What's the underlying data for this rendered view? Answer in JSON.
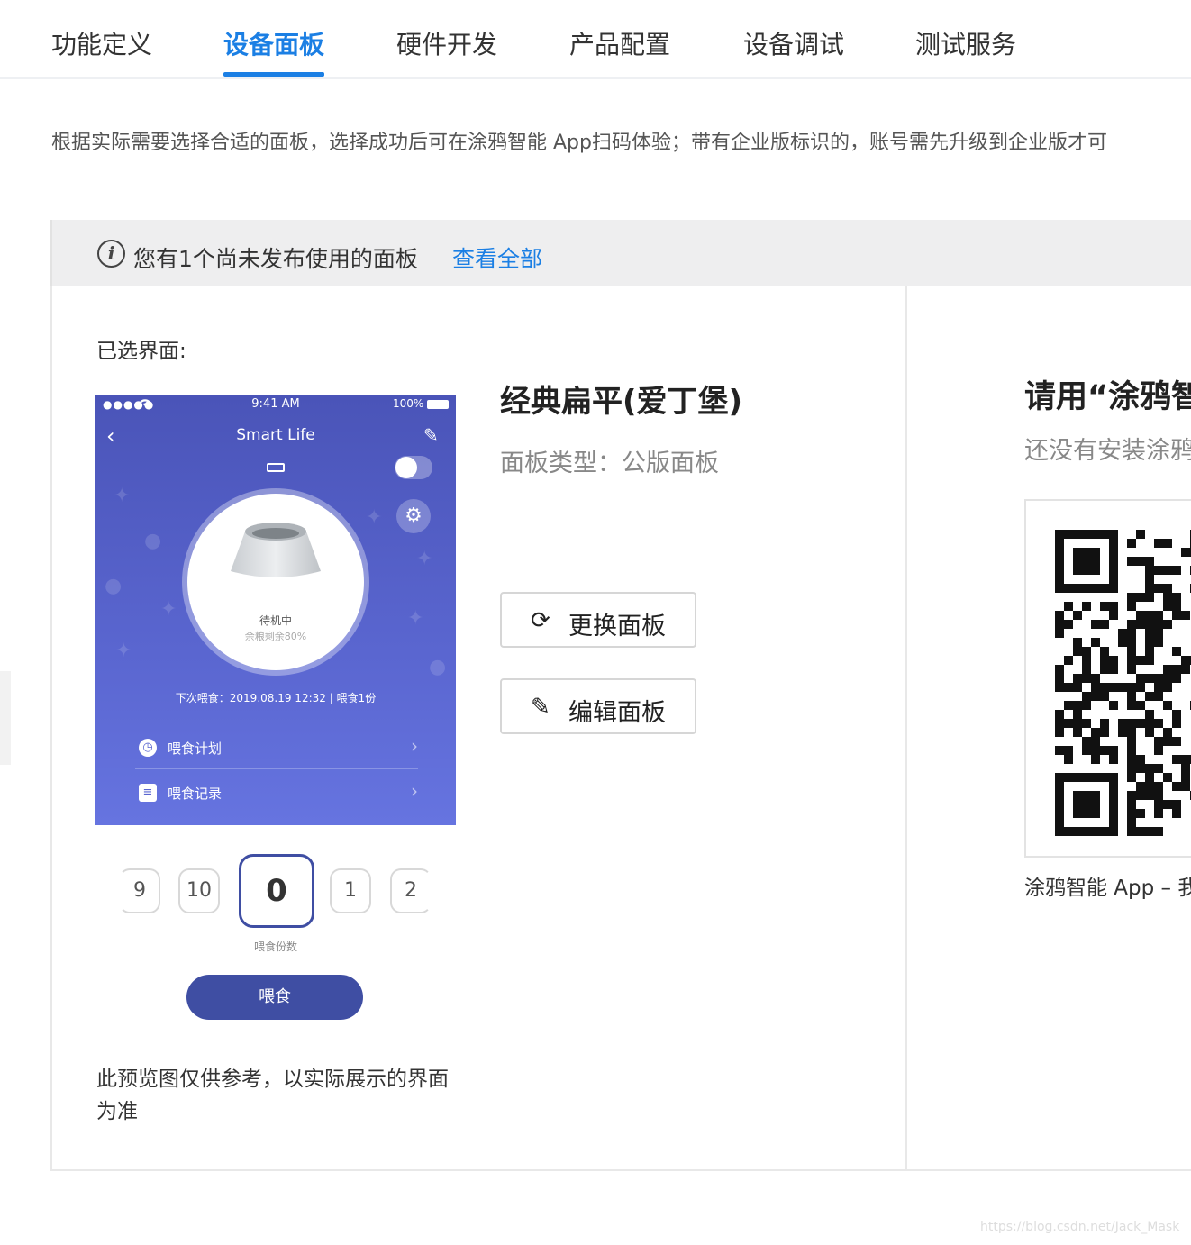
{
  "tabs": [
    {
      "label": "功能定义"
    },
    {
      "label": "设备面板"
    },
    {
      "label": "硬件开发"
    },
    {
      "label": "产品配置"
    },
    {
      "label": "设备调试"
    },
    {
      "label": "测试服务"
    }
  ],
  "active_tab": "设备面板",
  "description": "根据实际需要选择合适的面板，选择成功后可在涂鸦智能 App扫码体验；带有企业版标识的，账号需先升级到企业版才可",
  "notice": {
    "icon": "info-icon",
    "text": "您有1个尚未发布使用的面板",
    "link": "查看全部"
  },
  "selected_label": "已选界面:",
  "phone": {
    "status_dots": "●●●●●",
    "time": "9:41 AM",
    "battery": "100%",
    "title": "Smart Life",
    "status_main": "待机中",
    "status_sub": "余粮剩余80%",
    "next_feed": "下次喂食：2019.08.19 12:32 | 喂食1份",
    "rows": [
      {
        "label": "喂食计划",
        "icon": "clock-icon"
      },
      {
        "label": "喂食记录",
        "icon": "list-icon"
      }
    ],
    "picker": [
      "9",
      "10",
      "0",
      "1",
      "2"
    ],
    "picker_selected_index": 2,
    "picker_label": "喂食份数",
    "feed_button": "喂食",
    "colors": {
      "primary": "#3f4ea3",
      "gradient_top": "#4a54b8",
      "gradient_bottom": "#6674e0"
    }
  },
  "preview_note": "此预览图仅供参考，以实际展示的界面为准",
  "panel_info": {
    "name": "经典扁平(爱丁堡)",
    "type": "面板类型：公版面板",
    "replace_button": "更换面板",
    "edit_button": "编辑面板"
  },
  "right": {
    "scan_title": "请用“涂鸦智",
    "scan_sub": "还没有安装涂鸦",
    "app_caption": "涂鸦智能 App – 我"
  },
  "watermark": "https://blog.csdn.net/Jack_Mask",
  "accent_color": "#1b7fe4"
}
